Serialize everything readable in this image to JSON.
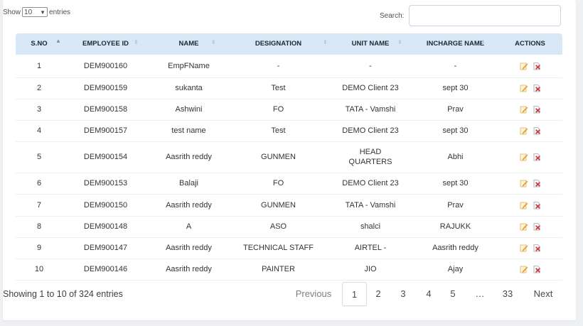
{
  "controls": {
    "show_label": "Show",
    "entries_value": "10",
    "entries_label": "entries",
    "search_label": "Search:",
    "search_value": "",
    "search_placeholder": ""
  },
  "table": {
    "columns": [
      "S.NO",
      "EMPLOYEE ID",
      "NAME",
      "DESIGNATION",
      "UNIT NAME",
      "INCHARGE NAME",
      "ACTIONS"
    ],
    "rows": [
      {
        "sno": "1",
        "emp_id": "DEM900160",
        "name": "EmpFName",
        "designation": "-",
        "unit": "-",
        "incharge": "-"
      },
      {
        "sno": "2",
        "emp_id": "DEM900159",
        "name": "sukanta",
        "designation": "Test",
        "unit": "DEMO Client 23",
        "incharge": "sept 30"
      },
      {
        "sno": "3",
        "emp_id": "DEM900158",
        "name": "Ashwini",
        "designation": "FO",
        "unit": "TATA - Vamshi",
        "incharge": "Prav"
      },
      {
        "sno": "4",
        "emp_id": "DEM900157",
        "name": "test name",
        "designation": "Test",
        "unit": "DEMO Client 23",
        "incharge": "sept 30"
      },
      {
        "sno": "5",
        "emp_id": "DEM900154",
        "name": "Aasrith reddy",
        "designation": "GUNMEN",
        "unit": "HEAD QUARTERS",
        "incharge": "Abhi"
      },
      {
        "sno": "6",
        "emp_id": "DEM900153",
        "name": "Balaji",
        "designation": "FO",
        "unit": "DEMO Client 23",
        "incharge": "sept 30"
      },
      {
        "sno": "7",
        "emp_id": "DEM900150",
        "name": "Aasrith reddy",
        "designation": "GUNMEN",
        "unit": "TATA - Vamshi",
        "incharge": "Prav"
      },
      {
        "sno": "8",
        "emp_id": "DEM900148",
        "name": "A",
        "designation": "ASO",
        "unit": "shalci",
        "incharge": "RAJUKK"
      },
      {
        "sno": "9",
        "emp_id": "DEM900147",
        "name": "Aasrith reddy",
        "designation": "TECHNICAL STAFF",
        "unit": "AIRTEL -",
        "incharge": "Aasrith reddy"
      },
      {
        "sno": "10",
        "emp_id": "DEM900146",
        "name": "Aasrith reddy",
        "designation": "PAINTER",
        "unit": "JIO",
        "incharge": "Ajay"
      }
    ]
  },
  "footer": {
    "info": "Showing 1 to 10 of 324 entries",
    "previous": "Previous",
    "pages": [
      "1",
      "2",
      "3",
      "4",
      "5",
      "…",
      "33"
    ],
    "next": "Next",
    "current_page": "1"
  },
  "icons": {
    "edit": "edit-icon",
    "delete": "delete-icon",
    "sort": "sort-icon",
    "dropdown": "chevron-down-icon"
  },
  "colors": {
    "header_bg": "#d8e8f6",
    "edit_icon": "#e0a22a",
    "delete_icon": "#d23a3a"
  }
}
